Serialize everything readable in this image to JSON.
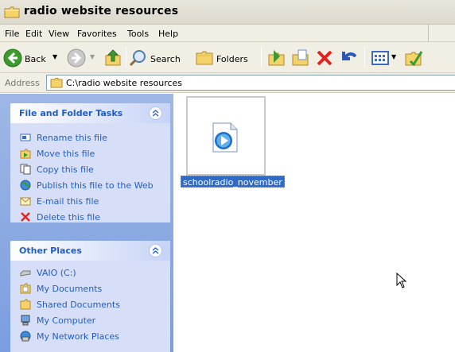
{
  "window": {
    "title": "radio website resources"
  },
  "menubar": {
    "items": [
      "File",
      "Edit",
      "View",
      "Favorites",
      "Tools",
      "Help"
    ]
  },
  "toolbar": {
    "back_label": "Back",
    "search_label": "Search",
    "folders_label": "Folders",
    "icons": [
      "back-icon",
      "forward-icon",
      "up-folder-icon",
      "search-icon",
      "folders-icon",
      "move-to-icon",
      "copy-to-icon",
      "delete-icon",
      "undo-icon",
      "views-icon",
      "folder-options-icon"
    ]
  },
  "address": {
    "label": "Address",
    "path": "C:\\radio website resources"
  },
  "file_tasks": {
    "title": "File and Folder Tasks",
    "items": [
      {
        "label": "Rename this file",
        "icon": "rename-icon"
      },
      {
        "label": "Move this file",
        "icon": "move-icon"
      },
      {
        "label": "Copy this file",
        "icon": "copy-icon"
      },
      {
        "label": "Publish this file to the Web",
        "icon": "publish-web-icon"
      },
      {
        "label": "E-mail this file",
        "icon": "email-icon"
      },
      {
        "label": "Delete this file",
        "icon": "delete-icon"
      }
    ]
  },
  "other_places": {
    "title": "Other Places",
    "items": [
      {
        "label": "VAIO (C:)",
        "icon": "drive-icon"
      },
      {
        "label": "My Documents",
        "icon": "my-documents-icon"
      },
      {
        "label": "Shared Documents",
        "icon": "shared-folder-icon"
      },
      {
        "label": "My Computer",
        "icon": "my-computer-icon"
      },
      {
        "label": "My Network Places",
        "icon": "network-places-icon"
      }
    ]
  },
  "files": [
    {
      "name": "schoolradio_november",
      "icon": "media-file-icon",
      "selected": true
    }
  ],
  "colors": {
    "task_link": "#215dc6",
    "selection": "#316ac5",
    "pane_bg": "#7b9de0"
  }
}
